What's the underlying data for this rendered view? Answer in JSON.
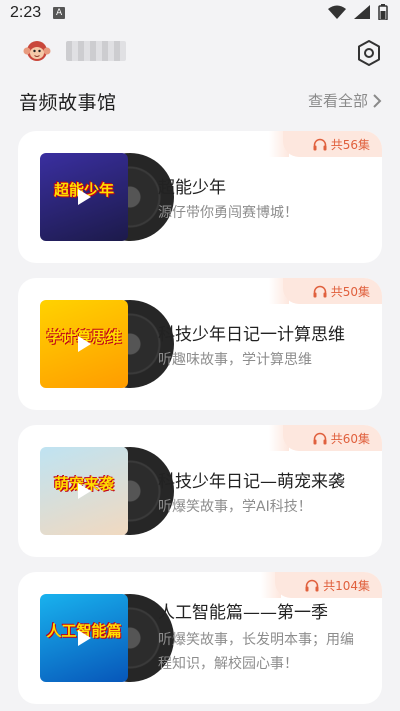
{
  "status_bar": {
    "time": "2:23",
    "notification_letter": "A"
  },
  "header": {
    "logo_text": "上海"
  },
  "section": {
    "title": "音频故事馆",
    "view_all": "查看全部"
  },
  "cards": [
    {
      "count": "共56集",
      "cover_text": "超能少年",
      "cover_colors": [
        "#3a2fa0",
        "#1c1a4a"
      ],
      "title": "超能少年",
      "desc": "源仔带你勇闯赛博城！"
    },
    {
      "count": "共50集",
      "cover_text": "学计算思维",
      "cover_colors": [
        "#ffd200",
        "#ff9c00"
      ],
      "title": "科技少年日记一计算思维",
      "desc": "听趣味故事，学计算思维"
    },
    {
      "count": "共60集",
      "cover_text": "萌宠来袭",
      "cover_colors": [
        "#bfe3f2",
        "#f1d9c0"
      ],
      "title": "科技少年日记—萌宠来袭",
      "desc": "听爆笑故事，学AI科技！"
    },
    {
      "count": "共104集",
      "cover_text": "人工智能篇",
      "cover_colors": [
        "#19b2ee",
        "#0756b9"
      ],
      "title": "人工智能篇——第一季",
      "desc": "听爆笑故事，长发明本事；用编程知识，解校园心事！"
    }
  ]
}
